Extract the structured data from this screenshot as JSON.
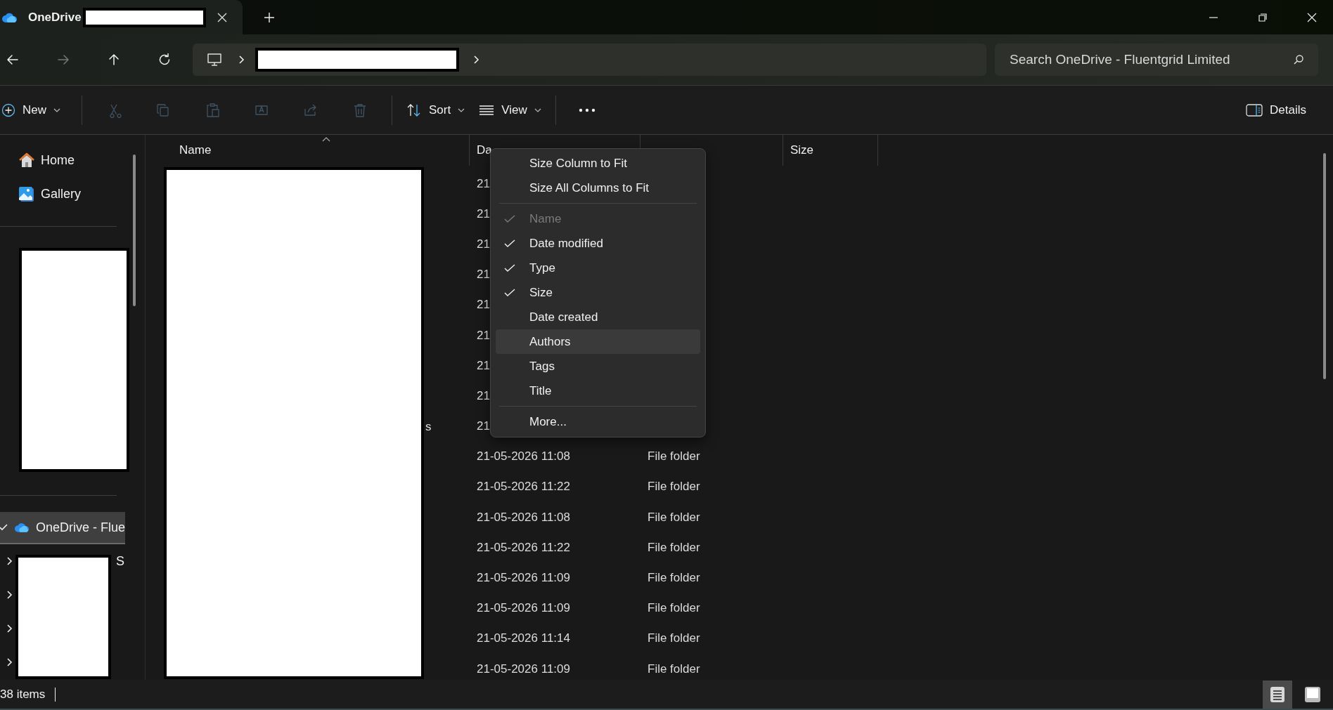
{
  "window": {
    "tab_title": "OneDrive"
  },
  "nav": [
    {
      "kind": "back",
      "disabled": false
    },
    {
      "kind": "forward",
      "disabled": true
    },
    {
      "kind": "up",
      "disabled": false
    },
    {
      "kind": "refresh",
      "disabled": false
    }
  ],
  "search": {
    "placeholder": "Search OneDrive - Fluentgrid Limited"
  },
  "commands": [
    {
      "kind": "new",
      "label": "New",
      "disabled": false
    },
    {
      "kind": "cut",
      "disabled": true
    },
    {
      "kind": "copy",
      "disabled": true
    },
    {
      "kind": "paste",
      "disabled": true
    },
    {
      "kind": "rename",
      "disabled": true
    },
    {
      "kind": "share",
      "disabled": true
    },
    {
      "kind": "delete",
      "disabled": true
    },
    {
      "kind": "sort",
      "label": "Sort",
      "disabled": false
    },
    {
      "kind": "view",
      "label": "View",
      "disabled": false
    },
    {
      "kind": "more",
      "disabled": false
    }
  ],
  "details_button": {
    "label": "Details"
  },
  "sidebar": {
    "quick": [
      {
        "kind": "home",
        "label": "Home"
      },
      {
        "kind": "gallery",
        "label": "Gallery"
      }
    ],
    "tree": [
      {
        "kind": "cloud",
        "label": "OneDrive - Flue",
        "selected": true,
        "expanded": true
      },
      {
        "kind": "folder",
        "label": "S",
        "selected": false,
        "expanded": false
      },
      {
        "kind": "folder",
        "selected": false,
        "expanded": false
      },
      {
        "kind": "folder",
        "selected": false,
        "expanded": false
      },
      {
        "kind": "folder",
        "selected": false,
        "expanded": false
      }
    ]
  },
  "table": {
    "header": {
      "name": {
        "label": "Name",
        "sorted": true
      },
      "date_modified": {
        "label": "Da"
      },
      "size": {
        "label": "Size"
      }
    },
    "rows": [
      {
        "date": "21"
      },
      {
        "date": "21"
      },
      {
        "date": "21"
      },
      {
        "date": "21"
      },
      {
        "date": "21"
      },
      {
        "date": "21"
      },
      {
        "date": "21"
      },
      {
        "date": "21"
      },
      {
        "name": "s",
        "date": "21"
      },
      {
        "date": "21-05-2026 11:08",
        "type": "File folder"
      },
      {
        "date": "21-05-2026 11:22",
        "type": "File folder"
      },
      {
        "date": "21-05-2026 11:08",
        "type": "File folder"
      },
      {
        "date": "21-05-2026 11:22",
        "type": "File folder"
      },
      {
        "date": "21-05-2026 11:09",
        "type": "File folder"
      },
      {
        "date": "21-05-2026 11:09",
        "type": "File folder"
      },
      {
        "date": "21-05-2026 11:14",
        "type": "File folder"
      },
      {
        "date": "21-05-2026 11:09",
        "type": "File folder"
      }
    ]
  },
  "context_menu": {
    "groups": [
      [
        {
          "kind": "command",
          "label": "Size Column to Fit",
          "highlighted": false
        },
        {
          "kind": "command",
          "label": "Size All Columns to Fit",
          "highlighted": false
        }
      ],
      [
        {
          "kind": "column",
          "label": "Name",
          "checked": true,
          "disabled": true,
          "highlighted": false
        },
        {
          "kind": "column",
          "label": "Date modified",
          "checked": true,
          "disabled": false,
          "highlighted": false
        },
        {
          "kind": "column",
          "label": "Type",
          "checked": true,
          "disabled": false,
          "highlighted": false
        },
        {
          "kind": "column",
          "label": "Size",
          "checked": true,
          "disabled": false,
          "highlighted": false
        },
        {
          "kind": "column",
          "label": "Date created",
          "checked": false,
          "disabled": false,
          "highlighted": false
        },
        {
          "kind": "column",
          "label": "Authors",
          "checked": false,
          "disabled": false,
          "highlighted": true
        },
        {
          "kind": "column",
          "label": "Tags",
          "checked": false,
          "disabled": false,
          "highlighted": false
        },
        {
          "kind": "column",
          "label": "Title",
          "checked": false,
          "disabled": false,
          "highlighted": false
        }
      ],
      [
        {
          "kind": "command",
          "label": "More...",
          "highlighted": false
        }
      ]
    ]
  },
  "status_bar": {
    "count": "38 items"
  },
  "layout_toggles": [
    {
      "kind": "details",
      "selected": true
    },
    {
      "kind": "tiles",
      "selected": false
    }
  ]
}
